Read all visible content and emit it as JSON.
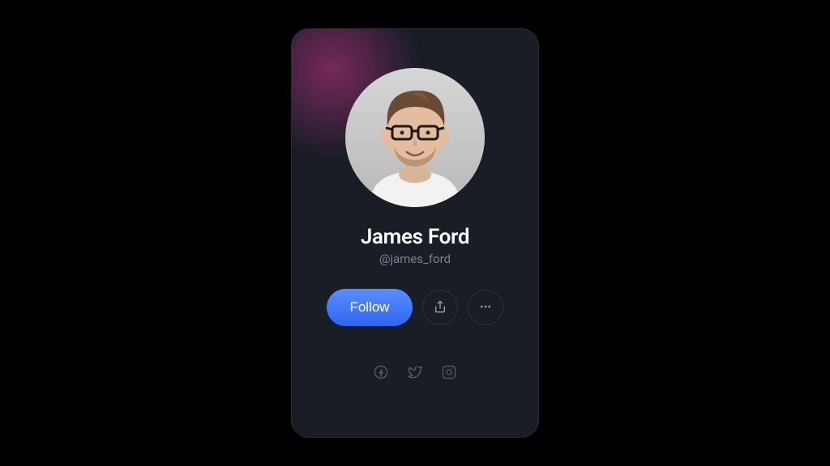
{
  "profile": {
    "name": "James Ford",
    "handle": "@james_ford"
  },
  "actions": {
    "follow_label": "Follow"
  },
  "icons": {
    "share": "share-icon",
    "more": "more-icon",
    "facebook": "facebook-icon",
    "twitter": "twitter-icon",
    "instagram": "instagram-icon"
  },
  "colors": {
    "accent": "#3a6ef5",
    "card_bg": "#191d26",
    "text_muted": "#7a8090"
  }
}
